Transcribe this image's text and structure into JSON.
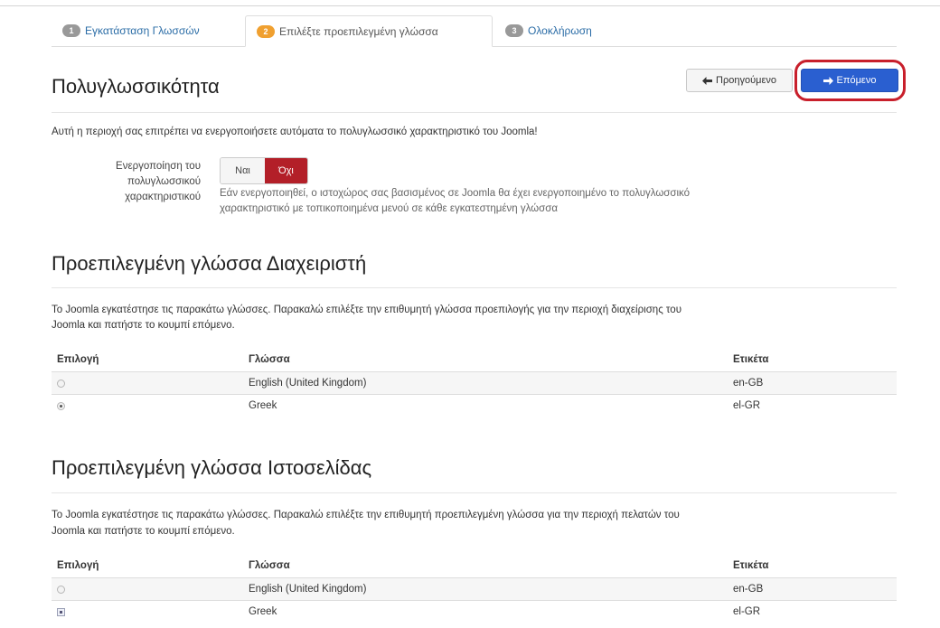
{
  "tabs": [
    {
      "num": "1",
      "label": "Εγκατάσταση Γλωσσών"
    },
    {
      "num": "2",
      "label": "Επιλέξτε προεπιλεγμένη γλώσσα"
    },
    {
      "num": "3",
      "label": "Ολοκλήρωση"
    }
  ],
  "section1": {
    "title": "Πολυγλωσσικότητα",
    "description": "Αυτή η περιοχή σας επιτρέπει να ενεργοποιήσετε αυτόματα το πολυγλωσσικό χαρακτηριστικό του Joomla!",
    "toggle_label": "Ενεργοποίηση του πολυγλωσσικού χαρακτηριστικού",
    "toggle_yes": "Ναι",
    "toggle_no": "Όχι",
    "toggle_selected": "Όχι",
    "help_line1": "Εάν ενεργοποιηθεί, ο ιστοχώρος σας βασισμένος σε Joomla θα έχει ενεργοποιημένο το πολυγλωσσικό",
    "help_line2": "χαρακτηριστικό με τοπικοποιημένα μενού σε κάθε εγκατεστημένη γλώσσα"
  },
  "buttons": {
    "prev_label": "Προηγούμενο",
    "prev_icon": "arrow-left-icon",
    "next_label": "Επόμενο",
    "next_icon": "arrow-right-icon"
  },
  "admin": {
    "title": "Προεπιλεγμένη γλώσσα Διαχειριστή",
    "desc_line1": "Το Joomla εγκατέστησε τις παρακάτω γλώσσες. Παρακαλώ επιλέξτε την επιθυμητή γλώσσα προεπιλογής για την περιοχή διαχείρισης του",
    "desc_line2": "Joomla και πατήστε το κουμπί επόμενο.",
    "headers": [
      "Επιλογή",
      "Γλώσσα",
      "Ετικέτα"
    ],
    "rows": [
      {
        "language": "English (United Kingdom)",
        "tag": "en-GB",
        "selected": false
      },
      {
        "language": "Greek",
        "tag": "el-GR",
        "selected": true
      }
    ]
  },
  "site": {
    "title": "Προεπιλεγμένη γλώσσα Ιστοσελίδας",
    "desc_line1": "Το Joomla εγκατέστησε τις παρακάτω γλώσσες. Παρακαλώ επιλέξτε την επιθυμητή προεπιλεγμένη γλώσσα για την περιοχή πελατών του",
    "desc_line2": "Joomla και πατήστε το κουμπί επόμενο.",
    "headers": [
      "Επιλογή",
      "Γλώσσα",
      "Ετικέτα"
    ],
    "rows": [
      {
        "language": "English (United Kingdom)",
        "tag": "en-GB",
        "selected": false
      },
      {
        "language": "Greek",
        "tag": "el-GR",
        "selected": true
      }
    ]
  },
  "colors": {
    "primary": "#2a5fd0",
    "danger": "#b31f28",
    "highlight": "#c81f2b",
    "step_active": "#f0a030"
  }
}
